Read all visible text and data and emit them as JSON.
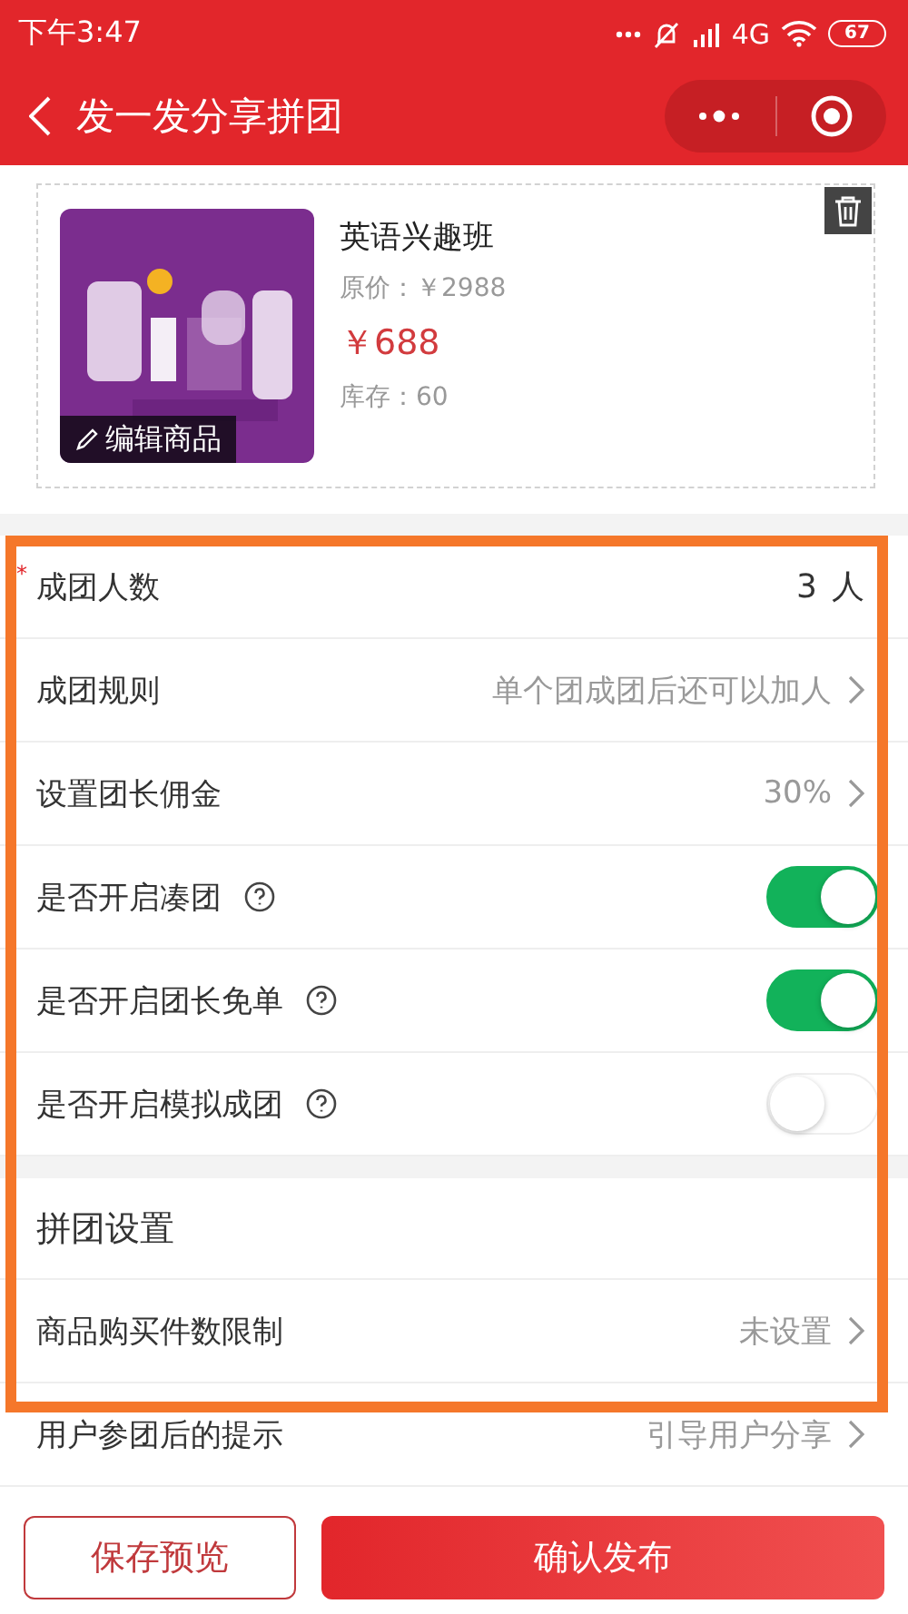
{
  "status_bar": {
    "time": "下午3:47",
    "network": "4G",
    "battery": "67"
  },
  "nav": {
    "title": "发一发分享拼团"
  },
  "product": {
    "name": "英语兴趣班",
    "original_price": "原价：￥2988",
    "price": "￥688",
    "stock": "库存：60",
    "edit_label": "编辑商品"
  },
  "settings": [
    {
      "kind": "count",
      "required_mark": "*",
      "label": "成团人数",
      "value": "3",
      "unit": "人"
    },
    {
      "kind": "link",
      "label": "成团规则",
      "value": "单个团成团后还可以加人"
    },
    {
      "kind": "link",
      "label": "设置团长佣金",
      "value": "30%"
    },
    {
      "kind": "toggle",
      "label": "是否开启凑团",
      "on": true
    },
    {
      "kind": "toggle",
      "label": "是否开启团长免单",
      "on": true
    },
    {
      "kind": "toggle",
      "label": "是否开启模拟成团",
      "on": false
    }
  ],
  "group_settings": {
    "title": "拼团设置",
    "rows": [
      {
        "kind": "link",
        "label": "商品购买件数限制",
        "value": "未设置"
      },
      {
        "kind": "link",
        "label": "用户参团后的提示",
        "value": "引导用户分享"
      }
    ]
  },
  "buttons": [
    {
      "kind": "outline",
      "label": "保存预览"
    },
    {
      "kind": "primary",
      "label": "确认发布"
    }
  ]
}
